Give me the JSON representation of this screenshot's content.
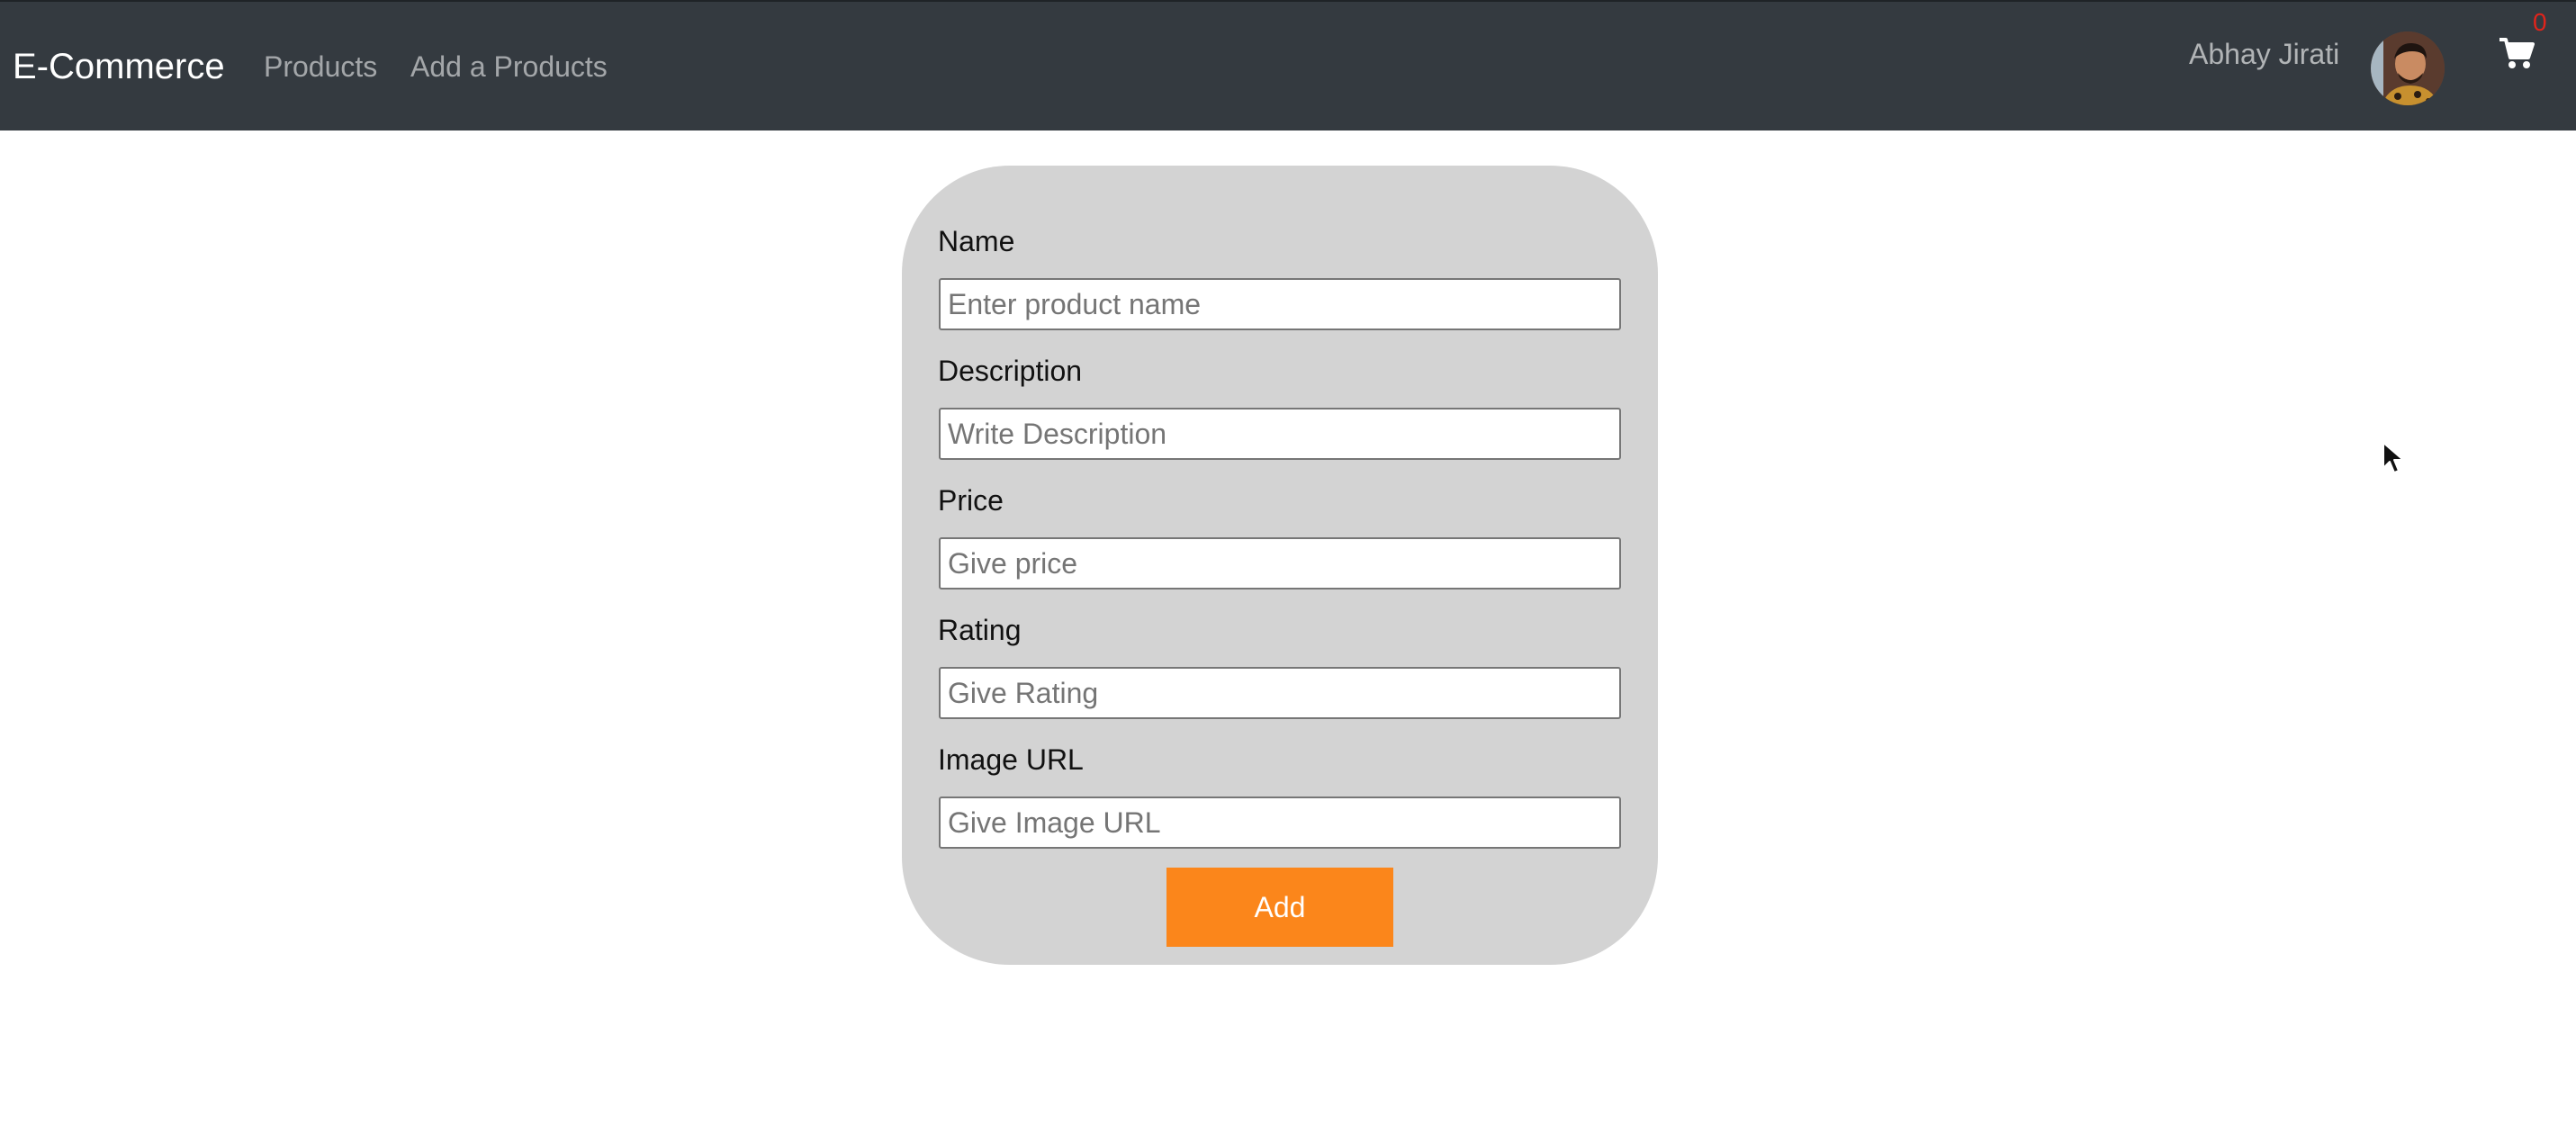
{
  "navbar": {
    "brand": "E-Commerce",
    "links": [
      "Products",
      "Add a Products"
    ],
    "user_name": "Abhay Jirati",
    "cart_count": "0",
    "colors": {
      "background": "#343a40",
      "cart_count": "#e0241b"
    }
  },
  "form": {
    "fields": [
      {
        "label": "Name",
        "placeholder": "Enter product name",
        "value": ""
      },
      {
        "label": "Description",
        "placeholder": "Write Description",
        "value": ""
      },
      {
        "label": "Price",
        "placeholder": "Give price",
        "value": ""
      },
      {
        "label": "Rating",
        "placeholder": "Give Rating",
        "value": ""
      },
      {
        "label": "Image URL",
        "placeholder": "Give Image URL",
        "value": ""
      }
    ],
    "submit_label": "Add",
    "colors": {
      "card_background": "#d3d3d3",
      "button": "#fb861b"
    }
  },
  "icons": {
    "cart": "shopping-cart-icon",
    "avatar": "user-avatar",
    "cursor": "mouse-pointer-icon"
  }
}
